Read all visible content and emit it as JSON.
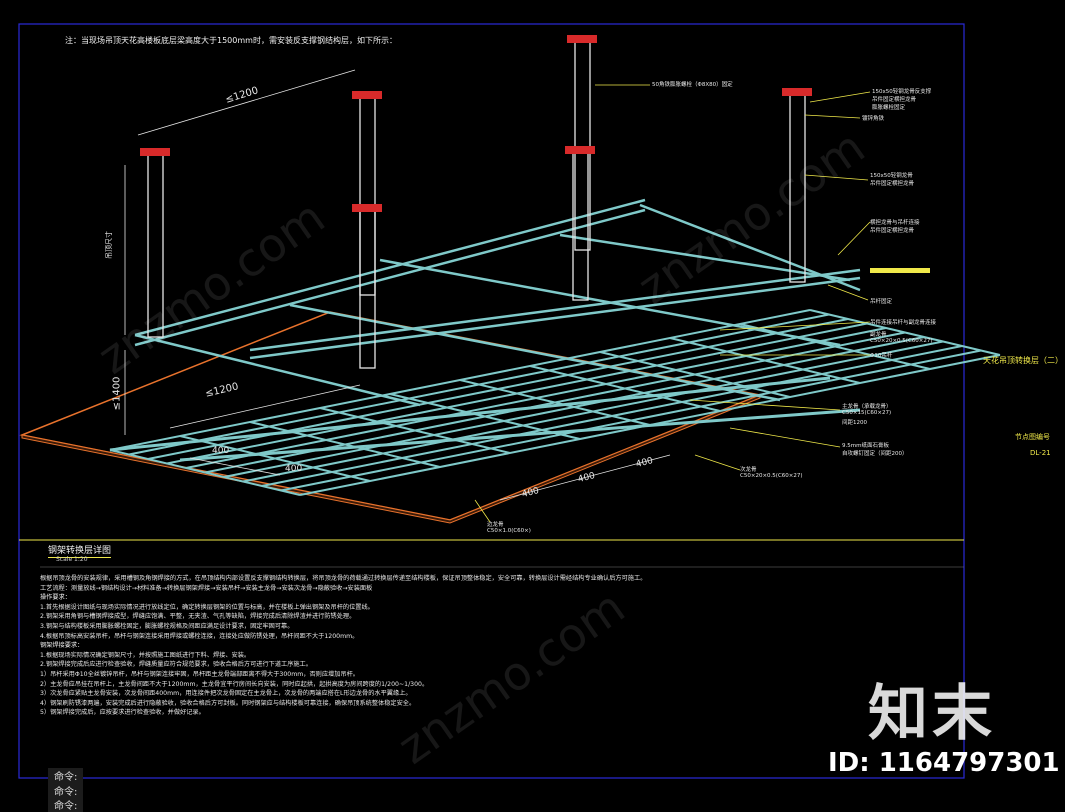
{
  "drawing": {
    "note_top": "注：当现场吊顶天花高楼板底层梁高度大于1500mm时，需安装反支撑钢结构层，如下所示：",
    "dim_labels": {
      "top_1200": "≤1200",
      "left_height": "吊顶尺寸",
      "mid_1200": "≤1200",
      "left_1400": "≤1400",
      "g400_a": "400",
      "g400_b": "400",
      "g400_c": "400",
      "g400_d": "400",
      "g400_e": "400"
    },
    "callouts": {
      "c1": "50角铁膨胀螺栓（Φ8X80）固定",
      "c2a": "150x50轻钢龙骨反支撑",
      "c2b": "吊件固定横担龙骨",
      "c2c": "膨胀螺栓固定",
      "c3": "镀锌角铁",
      "c4a": "150x50轻钢龙骨",
      "c4b": "吊件固定横担龙骨",
      "c5a": "横担龙骨与吊杆连接",
      "c5b": "吊件固定横担龙骨",
      "c6": "吊杆固定",
      "c7": "吊件连接吊杆与副龙骨连接",
      "c8a": "副龙骨",
      "c8b": "C50×20×0.5(C60×27)",
      "c9": "Φ10吊杆",
      "c10a": "主龙骨（承载龙骨）",
      "c10b": "C50×15(C60×27)",
      "c10c": "间距1200",
      "c11a": "9.5mm纸面石膏板",
      "c11b": "自攻螺钉固定（间距200）",
      "c12a": "次龙骨",
      "c12b": "C50×20×0.5(C60×27)",
      "c13a": "边龙骨",
      "c13b": "C50×1.0(C60×)"
    },
    "title": "钢架转换层详图",
    "scale": "Scale 1:20"
  },
  "notes": [
    {
      "text": "根据吊顶龙骨的安装规律，采用槽钢及角钢焊接的方式，在吊顶结构内部设置反支撑钢结构转换层，将吊顶龙骨的荷载通过转换层传递至结构楼板，保证吊顶整体稳定，安全可靠，转换层设计需经结构专业确认后方可施工。",
      "hd": false
    },
    {
      "text": "工艺流程：测量放线→钢结构设计→材料准备→转换层钢架焊接→安装吊杆→安装主龙骨→安装次龙骨→隐蔽验收→安装面板",
      "hd": false
    },
    {
      "text": "操作要求：",
      "hd": true
    },
    {
      "text": "1.首先根据设计图纸与现场实际情况进行放线定位，确定转换层钢架的位置与标高，并在楼板上弹出钢架及吊杆的位置线。",
      "hd": false
    },
    {
      "text": "2.钢架采用角钢与槽钢焊接成型，焊缝应饱满、平整，无夹渣、气孔等缺陷，焊接完成后清除焊渣并进行防锈处理。",
      "hd": false
    },
    {
      "text": "3.钢架与结构楼板采用膨胀螺栓固定，膨胀螺栓规格及间距应满足设计要求，固定牢固可靠。",
      "hd": false
    },
    {
      "text": "4.根据吊顶标高安装吊杆，吊杆与钢架连接采用焊接或螺栓连接，连接处应做防锈处理，吊杆间距不大于1200mm。",
      "hd": false
    },
    {
      "text": "钢架焊接要求：",
      "hd": true
    },
    {
      "text": "1.根据现场实际情况确定钢架尺寸，并按照施工图纸进行下料、焊接、安装。",
      "hd": false
    },
    {
      "text": "2.钢架焊接完成后应进行检查验收，焊缝质量应符合规范要求，验收合格后方可进行下道工序施工。",
      "hd": false
    },
    {
      "text": "1）吊杆采用Φ10全丝镀锌吊杆，吊杆与钢架连接牢固，吊杆距主龙骨端部距离不得大于300mm，否则应增加吊杆。",
      "hd": false
    },
    {
      "text": "2）主龙骨应吊挂在吊杆上，主龙骨间距不大于1200mm，主龙骨宜平行房间长向安装，同时应起拱，起拱高度为房间跨度的1/200~1/300。",
      "hd": false
    },
    {
      "text": "3）次龙骨应紧贴主龙骨安装，次龙骨间距400mm，用连接件把次龙骨固定在主龙骨上，次龙骨的两端应搭在L形边龙骨的水平翼缘上。",
      "hd": false
    },
    {
      "text": "4）钢架刷防锈漆两遍，安装完成后进行隐蔽验收，验收合格后方可封板。同时钢架应与结构楼板可靠连接，确保吊顶系统整体稳定安全。",
      "hd": false
    },
    {
      "text": "5）钢架焊接完成后，应按要求进行检查验收，并做好记录。",
      "hd": false
    }
  ],
  "commands": [
    "命令:",
    "命令:",
    "命令:"
  ],
  "side": {
    "title": "天花吊顶转换层（二）",
    "label": "节点图编号",
    "code": "DL-21"
  },
  "brand": "知末",
  "id_label": "ID: 1164797301",
  "watermark": "znzmo.com",
  "colors": {
    "background": "#000000",
    "steel": "#7fc9c9",
    "hanger": "#e8e8e8",
    "bracket": "#d82a2a",
    "ceiling_outline": "#e8722c",
    "leader": "#f0e94a",
    "frame": "#2a2ad8"
  }
}
